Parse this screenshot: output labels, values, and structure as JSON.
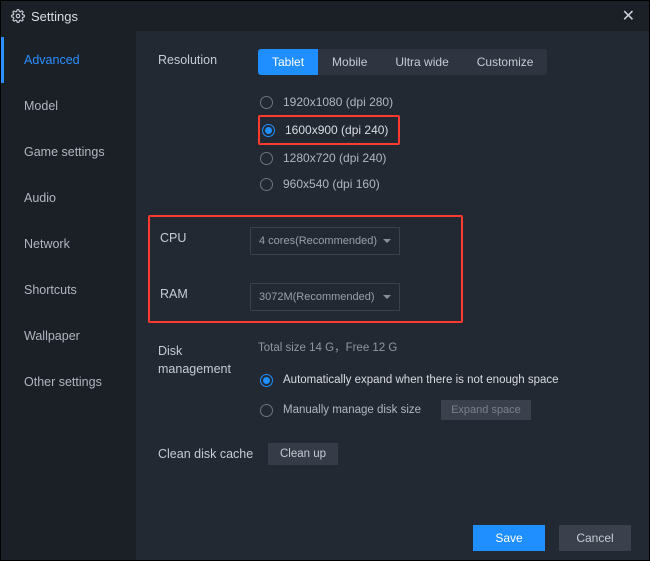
{
  "title": "Settings",
  "sidebar": {
    "items": [
      {
        "label": "Advanced",
        "active": true
      },
      {
        "label": "Model"
      },
      {
        "label": "Game settings"
      },
      {
        "label": "Audio"
      },
      {
        "label": "Network"
      },
      {
        "label": "Shortcuts"
      },
      {
        "label": "Wallpaper"
      },
      {
        "label": "Other settings"
      }
    ]
  },
  "resolution": {
    "label": "Resolution",
    "tabs": [
      {
        "label": "Tablet",
        "active": true
      },
      {
        "label": "Mobile"
      },
      {
        "label": "Ultra wide"
      },
      {
        "label": "Customize"
      }
    ],
    "options": [
      {
        "label": "1920x1080  (dpi 280)"
      },
      {
        "label": "1600x900  (dpi 240)",
        "selected": true,
        "highlight": true
      },
      {
        "label": "1280x720  (dpi 240)"
      },
      {
        "label": "960x540  (dpi 160)"
      }
    ]
  },
  "cpu": {
    "label": "CPU",
    "value": "4 cores(Recommended)"
  },
  "ram": {
    "label": "RAM",
    "value": "3072M(Recommended)"
  },
  "disk": {
    "label_line1": "Disk",
    "label_line2": "management",
    "info": "Total size 14 G，Free 12 G",
    "opt_auto": "Automatically expand when there is not enough space",
    "opt_manual": "Manually manage disk size",
    "expand_btn": "Expand space"
  },
  "clean": {
    "label": "Clean disk cache",
    "btn": "Clean up"
  },
  "footer": {
    "save": "Save",
    "cancel": "Cancel"
  }
}
